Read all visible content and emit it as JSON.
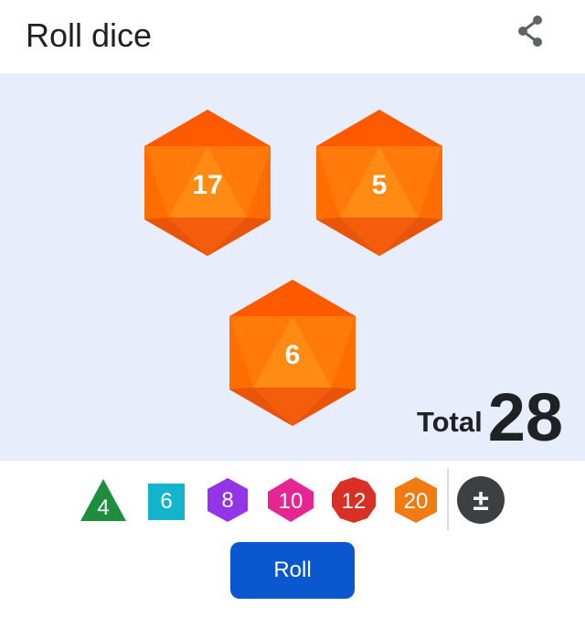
{
  "header": {
    "title": "Roll dice",
    "share_icon": "share-icon"
  },
  "colors": {
    "stage_background": "#e8edfc",
    "d20_orange": "#ff6d00",
    "roll_button": "#0b57d0"
  },
  "dice": [
    {
      "type": "d20",
      "value": "17"
    },
    {
      "type": "d20",
      "value": "5"
    },
    {
      "type": "d20",
      "value": "6"
    }
  ],
  "total": {
    "label": "Total",
    "value": "28"
  },
  "dice_types": [
    {
      "label": "4",
      "shape": "triangle",
      "color": "#1e8e3e"
    },
    {
      "label": "6",
      "shape": "square",
      "color": "#12b5cb"
    },
    {
      "label": "8",
      "shape": "hexagon",
      "color": "#9334e6"
    },
    {
      "label": "10",
      "shape": "diamond-hexagon",
      "color": "#e52592"
    },
    {
      "label": "12",
      "shape": "decagon",
      "color": "#d93025"
    },
    {
      "label": "20",
      "shape": "hexagon",
      "color": "#f07b12"
    }
  ],
  "modifier": {
    "label": "±",
    "color": "#3c4043"
  },
  "roll_button": {
    "label": "Roll"
  }
}
